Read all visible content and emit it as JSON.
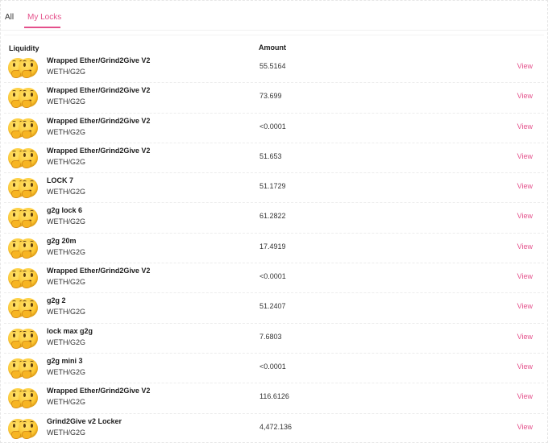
{
  "tabs": {
    "all_label": "All",
    "mine_label": "My Locks"
  },
  "table": {
    "col_liquidity": "Liquidity",
    "col_amount": "Amount",
    "view_label": "View",
    "rows": [
      {
        "name": "Wrapped Ether/Grind2Give V2",
        "pair": "WETH/G2G",
        "amount": "55.5164"
      },
      {
        "name": "Wrapped Ether/Grind2Give V2",
        "pair": "WETH/G2G",
        "amount": "73.699"
      },
      {
        "name": "Wrapped Ether/Grind2Give V2",
        "pair": "WETH/G2G",
        "amount": "<0.0001"
      },
      {
        "name": "Wrapped Ether/Grind2Give V2",
        "pair": "WETH/G2G",
        "amount": "51.653"
      },
      {
        "name": "LOCK 7",
        "pair": "WETH/G2G",
        "amount": "51.1729"
      },
      {
        "name": "g2g lock 6",
        "pair": "WETH/G2G",
        "amount": "61.2822"
      },
      {
        "name": "g2g 20m",
        "pair": "WETH/G2G",
        "amount": "17.4919"
      },
      {
        "name": "Wrapped Ether/Grind2Give V2",
        "pair": "WETH/G2G",
        "amount": "<0.0001"
      },
      {
        "name": "g2g 2",
        "pair": "WETH/G2G",
        "amount": "51.2407"
      },
      {
        "name": "lock max g2g",
        "pair": "WETH/G2G",
        "amount": "7.6803"
      },
      {
        "name": "g2g mini 3",
        "pair": "WETH/G2G",
        "amount": "<0.0001"
      },
      {
        "name": "Wrapped Ether/Grind2Give V2",
        "pair": "WETH/G2G",
        "amount": "116.6126"
      },
      {
        "name": "Grind2Give v2 Locker",
        "pair": "WETH/G2G",
        "amount": "4,472.136"
      }
    ]
  },
  "icons": {
    "token_avatar": "thinking-face-pair-icon"
  },
  "colors": {
    "accent": "#e4508b"
  }
}
